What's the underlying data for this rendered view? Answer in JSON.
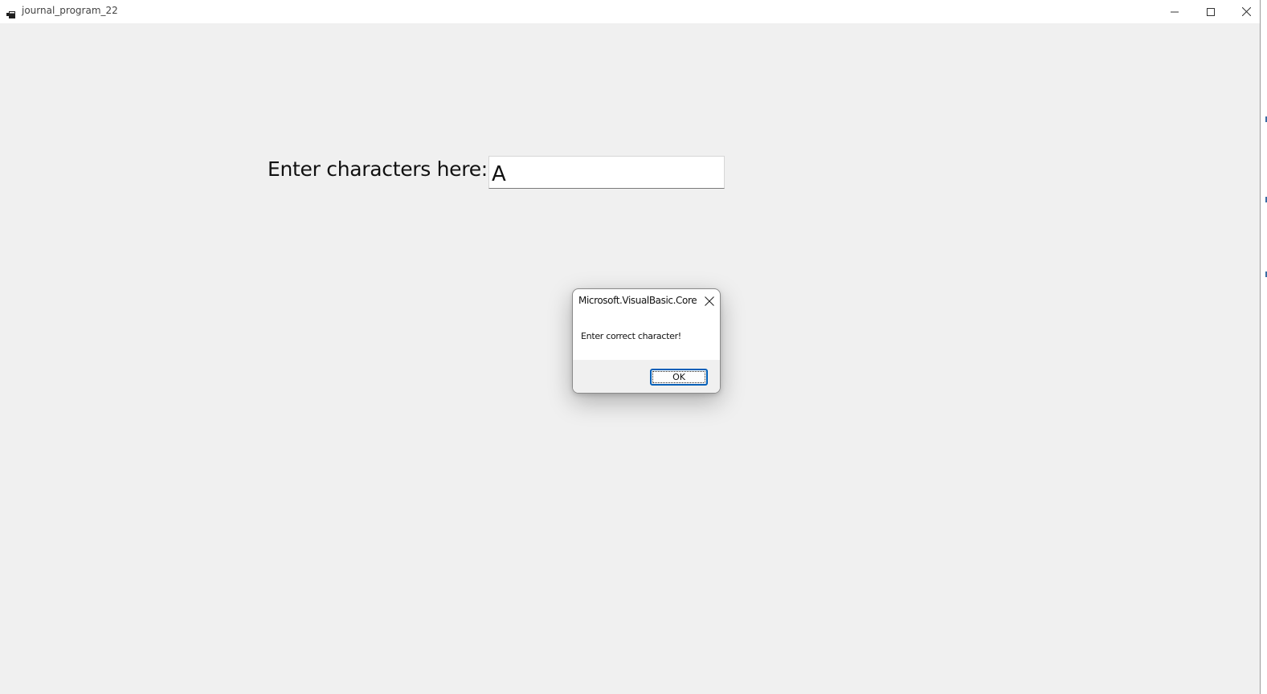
{
  "window": {
    "title": "journal_program_22",
    "icon": "app-window-icon",
    "controls": {
      "minimize_icon": "minimize-icon",
      "maximize_icon": "maximize-icon",
      "close_icon": "close-icon"
    }
  },
  "form": {
    "label": "Enter characters here:",
    "input_value": "A"
  },
  "dialog": {
    "title": "Microsoft.VisualBasic.Core",
    "message": "Enter correct character!",
    "ok_label": "OK",
    "close_icon": "close-icon"
  },
  "colors": {
    "background": "#f0f0f0",
    "titlebar": "#ffffff",
    "focus_accent": "#005fb8"
  }
}
